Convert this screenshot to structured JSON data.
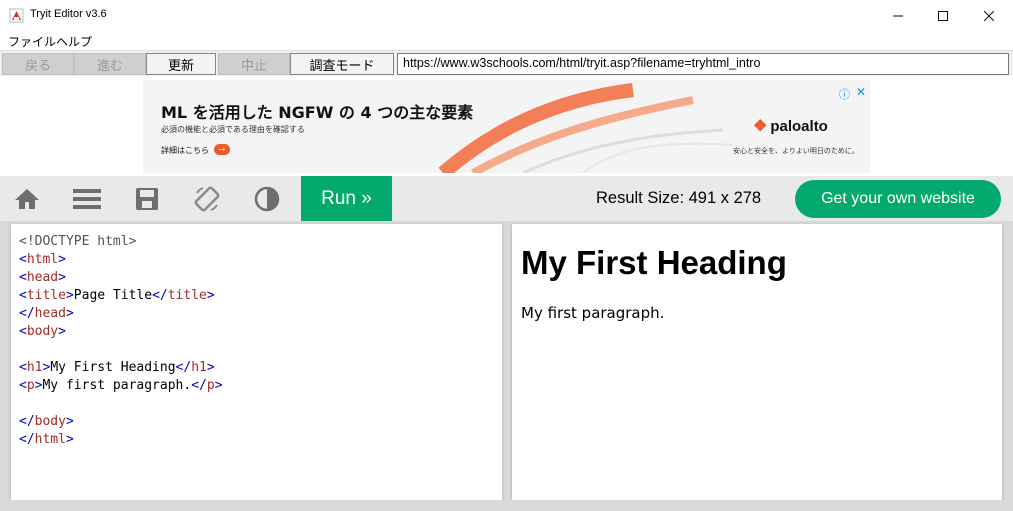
{
  "window": {
    "title": "Tryit Editor v3.6",
    "icon": "app-icon",
    "controls": {
      "minimize": "–",
      "maximize": "☐",
      "close": "✕"
    }
  },
  "menu": {
    "items": [
      {
        "label": "ファイル"
      },
      {
        "label": "ヘルプ"
      }
    ]
  },
  "nav": {
    "back": "戻る",
    "forward": "進む",
    "refresh": "更新",
    "stop": "中止",
    "debug": "調査モード",
    "url": "https://www.w3schools.com/html/tryit.asp?filename=tryhtml_intro"
  },
  "ad": {
    "headline": "ML を活用した NGFW の 4 つの主な要素",
    "sub": "必須の機能と必須である理由を確認する",
    "cta": "詳細はこちら",
    "brand": "paloalto",
    "tagline": "安心と安全を、よりよい明日のために。",
    "colors": {
      "accent": "#ef5a26",
      "info": "#1a8bd6"
    }
  },
  "toolbar": {
    "icons": [
      "home-icon",
      "menu-icon",
      "save-icon",
      "rotate-icon",
      "theme-icon"
    ],
    "run_label": "Run »",
    "result_size_label": "Result Size: 491 x 278",
    "get_website_label": "Get your own website",
    "colors": {
      "green": "#04aa6d",
      "bar": "#e7e9eb"
    }
  },
  "code": {
    "lines": [
      {
        "kind": "doctype",
        "text": "<!DOCTYPE html>"
      },
      {
        "kind": "tag",
        "tag": "html",
        "closing": false
      },
      {
        "kind": "tag",
        "tag": "head",
        "closing": false
      },
      {
        "kind": "wrap",
        "tag": "title",
        "text": "Page Title"
      },
      {
        "kind": "tag",
        "tag": "head",
        "closing": true
      },
      {
        "kind": "tag",
        "tag": "body",
        "closing": false
      },
      {
        "kind": "blank"
      },
      {
        "kind": "wrap",
        "tag": "h1",
        "text": "My First Heading"
      },
      {
        "kind": "wrap",
        "tag": "p",
        "text": "My first paragraph."
      },
      {
        "kind": "blank"
      },
      {
        "kind": "tag",
        "tag": "body",
        "closing": true
      },
      {
        "kind": "tag",
        "tag": "html",
        "closing": true
      }
    ],
    "colors": {
      "tag": "#a52a2a",
      "bracket": "#0000cd"
    }
  },
  "result": {
    "heading": "My First Heading",
    "paragraph": "My first paragraph."
  }
}
